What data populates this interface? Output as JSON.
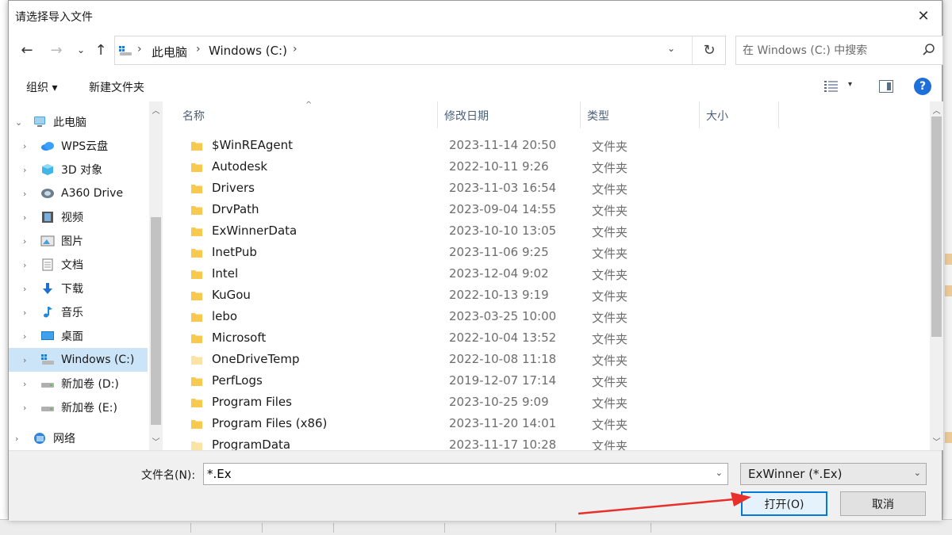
{
  "dialog": {
    "title": "请选择导入文件",
    "close_glyph": "✕"
  },
  "nav": {
    "back": "←",
    "forward": "→",
    "recent": "⌄",
    "up": "↑"
  },
  "address": {
    "crumbs": [
      "此电脑",
      "Windows (C:)"
    ],
    "sep": "›",
    "dropdown": "⌄",
    "refresh": "↻"
  },
  "search": {
    "placeholder": "在 Windows (C:) 中搜索"
  },
  "toolbar": {
    "organize": "组织 ▾",
    "new_folder": "新建文件夹",
    "view_dd": "▾",
    "help": "?"
  },
  "sidebar": {
    "items": [
      {
        "label": "此电脑",
        "icon": "computer-icon",
        "expanded": true
      },
      {
        "label": "WPS云盘",
        "icon": "cloud-icon"
      },
      {
        "label": "3D 对象",
        "icon": "cube-icon"
      },
      {
        "label": "A360 Drive",
        "icon": "a360-icon"
      },
      {
        "label": "视频",
        "icon": "video-icon"
      },
      {
        "label": "图片",
        "icon": "picture-icon"
      },
      {
        "label": "文档",
        "icon": "document-icon"
      },
      {
        "label": "下载",
        "icon": "download-icon"
      },
      {
        "label": "音乐",
        "icon": "music-icon"
      },
      {
        "label": "桌面",
        "icon": "desktop-icon"
      },
      {
        "label": "Windows (C:)",
        "icon": "windows-drive-icon",
        "selected": true
      },
      {
        "label": "新加卷 (D:)",
        "icon": "drive-icon"
      },
      {
        "label": "新加卷 (E:)",
        "icon": "drive-icon"
      },
      {
        "label": "网络",
        "icon": "network-icon"
      }
    ],
    "chev_right": "›",
    "chev_down": "⌄"
  },
  "columns": {
    "name": "名称",
    "date": "修改日期",
    "type": "类型",
    "size": "大小",
    "sort_glyph": "^"
  },
  "files": [
    {
      "name": "$WinREAgent",
      "date": "2023-11-14 20:50",
      "type": "文件夹"
    },
    {
      "name": "Autodesk",
      "date": "2022-10-11 9:26",
      "type": "文件夹"
    },
    {
      "name": "Drivers",
      "date": "2023-11-03 16:54",
      "type": "文件夹"
    },
    {
      "name": "DrvPath",
      "date": "2023-09-04 14:55",
      "type": "文件夹"
    },
    {
      "name": "ExWinnerData",
      "date": "2023-10-10 13:05",
      "type": "文件夹"
    },
    {
      "name": "InetPub",
      "date": "2023-11-06 9:25",
      "type": "文件夹"
    },
    {
      "name": "Intel",
      "date": "2023-12-04 9:02",
      "type": "文件夹"
    },
    {
      "name": "KuGou",
      "date": "2022-10-13 9:19",
      "type": "文件夹"
    },
    {
      "name": "lebo",
      "date": "2023-03-25 10:00",
      "type": "文件夹"
    },
    {
      "name": "Microsoft",
      "date": "2022-10-04 13:52",
      "type": "文件夹"
    },
    {
      "name": "OneDriveTemp",
      "date": "2022-10-08 11:18",
      "type": "文件夹"
    },
    {
      "name": "PerfLogs",
      "date": "2019-12-07 17:14",
      "type": "文件夹"
    },
    {
      "name": "Program Files",
      "date": "2023-10-25 9:09",
      "type": "文件夹"
    },
    {
      "name": "Program Files (x86)",
      "date": "2023-11-20 14:01",
      "type": "文件夹"
    },
    {
      "name": "ProgramData",
      "date": "2023-11-17 10:28",
      "type": "文件夹"
    }
  ],
  "scroll": {
    "up": "︿",
    "down": "﹀"
  },
  "filename": {
    "label": "文件名(N):",
    "value": "*.Ex",
    "dd": "⌄"
  },
  "filetype": {
    "value": "ExWinner (*.Ex)",
    "dd": "⌄"
  },
  "buttons": {
    "open": "打开(O)",
    "cancel": "取消"
  },
  "colors": {
    "accent": "#0078d7",
    "selection": "#cce4f7",
    "folder": "#f8c94f",
    "annotation_arrow": "#e8302a"
  }
}
